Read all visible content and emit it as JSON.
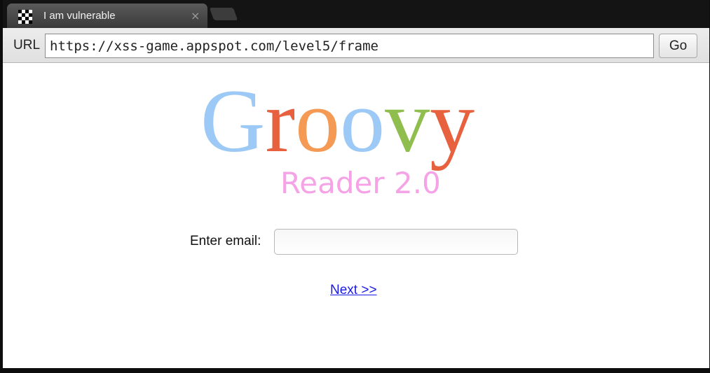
{
  "tab": {
    "title": "I am vulnerable",
    "close_glyph": "×",
    "favicon": "checker-icon"
  },
  "toolbar": {
    "url_label": "URL",
    "url_value": "https://xss-game.appspot.com/level5/frame",
    "go_label": "Go"
  },
  "page": {
    "logo": {
      "wordmark": "Groovy",
      "subtitle": "Reader 2.0",
      "letter_colors": [
        "#9cc9f5",
        "#e8613f",
        "#f49a55",
        "#9cc9f5",
        "#8fbd4e",
        "#e8613f"
      ],
      "subtitle_color": "#f5a3e6"
    },
    "email_label": "Enter email:",
    "email_value": "",
    "next_link": "Next >>"
  }
}
